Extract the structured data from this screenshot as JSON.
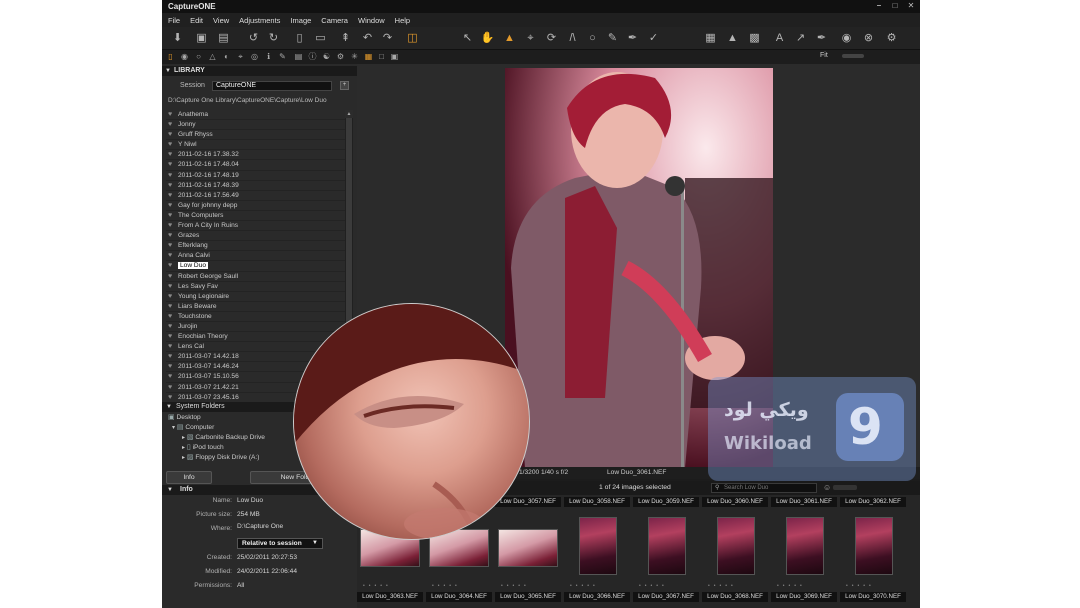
{
  "app": {
    "title": "CaptureONE"
  },
  "menu": [
    "File",
    "Edit",
    "View",
    "Adjustments",
    "Image",
    "Camera",
    "Window",
    "Help"
  ],
  "library": {
    "title": "LIBRARY",
    "session_label": "Session",
    "session_value": "CaptureONE",
    "path": "D:\\Capture One Library\\CaptureONE\\Capture\\Low Duo",
    "albums": [
      "Anathema",
      "Jonny",
      "Gruff Rhyss",
      "Y Niwl",
      "2011-02-16 17.38.32",
      "2011-02-16 17.48.04",
      "2011-02-16 17.48.19",
      "2011-02-16 17.48.39",
      "2011-02-16 17.56.49",
      "Gay for johnny depp",
      "The Computers",
      "From A City In Ruins",
      "Grazes",
      "Efterklang",
      "Anna Calvi",
      "Low Duo",
      "Robert George Saull",
      "Les Savy Fav",
      "Young Legionaire",
      "Liars Beware",
      "Touchstone",
      "Jurojin",
      "Enochian Theory",
      "Lens Cal",
      "2011-03-07 14.42.18",
      "2011-03-07 14.46.24",
      "2011-03-07 15.10.56",
      "2011-03-07 21.42.21",
      "2011-03-07 23.45.16"
    ],
    "selected_album": "Low Duo",
    "system_folders_title": "System Folders",
    "tree": [
      "Desktop",
      "Computer",
      "Carbonite Backup Drive",
      "iPod touch",
      "Floppy Disk Drive (A:)"
    ],
    "info_button": "Info",
    "new_folder_button": "New Folder"
  },
  "info": {
    "title": "Info",
    "name_label": "Name:",
    "name_value": "Low Duo",
    "size_label": "Picture size:",
    "size_value": "254 MB",
    "where_label": "Where:",
    "where_value": "D:\\Capture One",
    "relative": "Relative to session",
    "created_label": "Created:",
    "created_value": "25/02/2011 20:27:53",
    "modified_label": "Modified:",
    "modified_value": "24/02/2011 22:06:44",
    "permissions_label": "Permissions:",
    "permissions_value": "All"
  },
  "viewer": {
    "exif": "1/3200 1/40 s f/2",
    "filename": "Low Duo_3061.NEF",
    "fit_label": "Fit"
  },
  "browser": {
    "count": "1 of 24 images selected",
    "search_placeholder": "Search Low Duo",
    "top_labels": [
      "Low Duo_3057.NEF",
      "Low Duo_3058.NEF",
      "Low Duo_3059.NEF",
      "Low Duo_3060.NEF",
      "Low Duo_3061.NEF",
      "Low Duo_3062.NEF"
    ],
    "bottom_labels": [
      "Low Duo_3063.NEF",
      "Low Duo_3064.NEF",
      "Low Duo_3065.NEF",
      "Low Duo_3066.NEF",
      "Low Duo_3067.NEF",
      "Low Duo_3068.NEF",
      "Low Duo_3069.NEF",
      "Low Duo_3070.NEF"
    ]
  },
  "watermark": {
    "arabic": "ويكي لود",
    "latin": "Wikiload",
    "logo_glyph": "9"
  },
  "colors": {
    "accent": "#e39a2b",
    "app_bg": "#1c1c1c",
    "panel_bg": "#2a2a2a"
  },
  "icons": {
    "toolbar": [
      "import-icon",
      "capture-icon",
      "export-icon",
      "rotate-left-icon",
      "rotate-right-icon",
      "folder-icon",
      "trash-icon",
      "undo-icon",
      "redo-icon",
      "batch-icon",
      "layers-icon",
      "cursor-icon",
      "pan-icon",
      "zoom-icon",
      "crop-icon",
      "rotate-icon",
      "keystone-icon",
      "spot-icon",
      "brush-icon",
      "eyedropper-icon",
      "grid-icon",
      "warning-icon",
      "text-icon",
      "arrow-icon",
      "camera-icon",
      "settings-icon"
    ]
  }
}
